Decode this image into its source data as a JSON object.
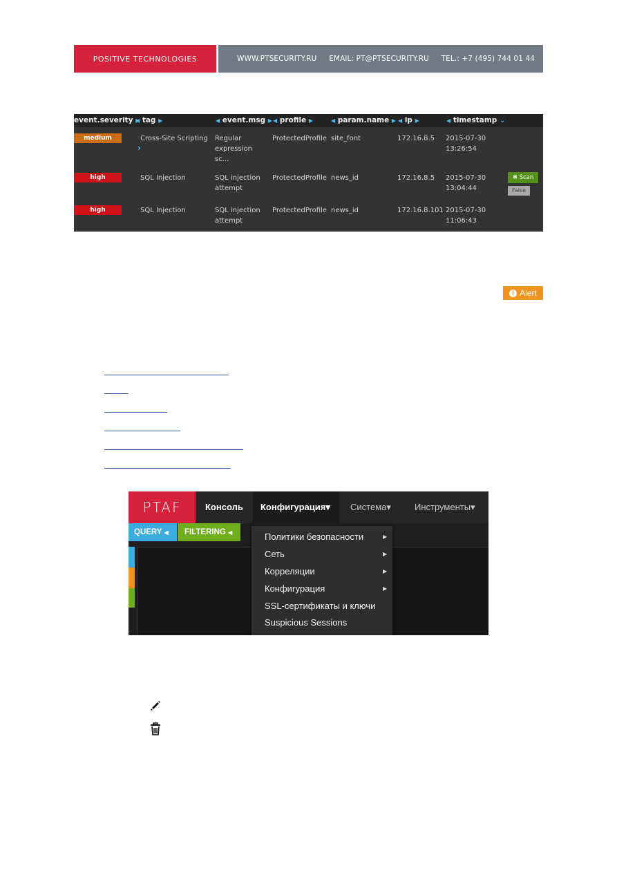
{
  "header": {
    "brand": "POSITIVE TECHNOLOGIES",
    "website": "WWW.PTSECURITY.RU",
    "email": "EMAIL: PT@PTSECURITY.RU",
    "phone": "TEL.: +7 (495) 744 01 44"
  },
  "event_table": {
    "columns": [
      "event.severity",
      "tag",
      "event.msg",
      "profile",
      "param.name",
      "ip",
      "timestamp"
    ],
    "rows": [
      {
        "severity": "medium",
        "tag": "Cross-Site Scripting",
        "msg": [
          "Regular",
          "expression",
          "sc..."
        ],
        "profile": "ProtectedProfile",
        "param": "site_font",
        "ip": "172.16.8.5",
        "date": "2015-07-30",
        "time": "13:26:54"
      },
      {
        "severity": "high",
        "tag": "SQL Injection",
        "msg": [
          "SQL injection",
          "attempt"
        ],
        "profile": "ProtectedProfile",
        "param": "news_id",
        "ip": "172.16.8.5",
        "date": "2015-07-30",
        "time": "13:04:44",
        "scan_label": "Scan",
        "false_label": "False"
      },
      {
        "severity": "high",
        "tag": "SQL Injection",
        "msg": [
          "SQL injection",
          "attempt"
        ],
        "profile": "ProtectedProfile",
        "param": "news_id",
        "ip": "172.16.8.101",
        "date": "2015-07-30",
        "time": "11:06:43"
      }
    ]
  },
  "alert": {
    "label": "Alert",
    "icon": "!"
  },
  "ptaf": {
    "logo": "PTAF",
    "nav": {
      "console": "Консоль",
      "config": "Конфигурация",
      "system": "Система",
      "tools": "Инструменты",
      "caret": "▾"
    },
    "query_label": "QUERY",
    "filtering_label": "FILTERING",
    "menu": {
      "item1": "Политики безопасности",
      "item2": "Сеть",
      "item3": "Корреляции",
      "item4": "Конфигурация",
      "item5": "SSL-сертификаты и ключи",
      "item6": "Suspicious Sessions"
    }
  },
  "colors": {
    "brand_red": "#d6213a",
    "banner_gray": "#6f7b86",
    "severity_medium": "#cc6d11",
    "severity_high": "#d0121b",
    "alert_orange": "#f0931f",
    "query_blue": "#3cace0",
    "filtering_green": "#6fae1c",
    "link_blue": "#2d5aa8"
  },
  "icons": [
    "info-circle-icon",
    "chevron-right-icon",
    "bug-icon",
    "pencil-icon",
    "trash-icon"
  ]
}
